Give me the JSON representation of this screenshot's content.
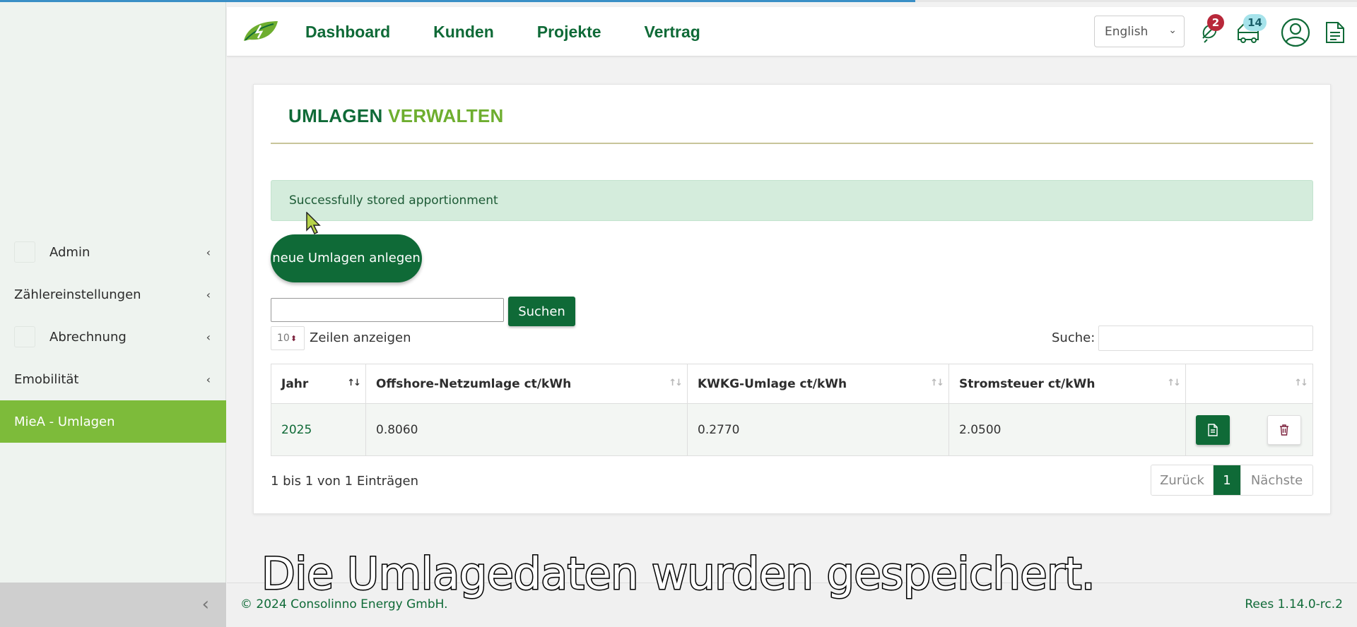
{
  "navigation": {
    "items": [
      "Dashboard",
      "Kunden",
      "Projekte",
      "Vertrag"
    ]
  },
  "header": {
    "language": "English",
    "notifications_count": "2",
    "messages_count": "14"
  },
  "sidebar": {
    "items": [
      {
        "label": "Admin"
      },
      {
        "label": "Zählereinstellungen"
      },
      {
        "label": "Abrechnung"
      },
      {
        "label": "Emobilität"
      },
      {
        "label": "MieA - Umlagen"
      }
    ],
    "active_index": 4
  },
  "page": {
    "title_part1": "UMLAGEN",
    "title_part2": "VERWALTEN",
    "alert": "Successfully stored apportionment",
    "new_button": "neue Umlagen anlegen",
    "search_button": "Suchen",
    "search_value": "",
    "length_value": "10",
    "length_label": "Zeilen anzeigen",
    "filter_label": "Suche:"
  },
  "table": {
    "columns": [
      "Jahr",
      "Offshore-Netzumlage ct/kWh",
      "KWKG-Umlage ct/kWh",
      "Stromsteuer ct/kWh",
      ""
    ],
    "rows": [
      {
        "year": "2025",
        "offshore": "0.8060",
        "kwkg": "0.2770",
        "stromsteuer": "2.0500"
      }
    ],
    "info": "1 bis 1 von 1 Einträgen",
    "pagination": {
      "prev": "Zurück",
      "current": "1",
      "next": "Nächste"
    }
  },
  "caption": "Die Umlagedaten wurden gespeichert.",
  "footer": {
    "copyright": "© 2024 Consolinno Energy GmbH.",
    "version": "Rees 1.14.0-rc.2"
  },
  "colors": {
    "primary": "#0f6a37",
    "accent": "#7dbb3a",
    "alert_bg": "#d4ecdc",
    "badge_red": "#b8283a",
    "badge_cyan": "#a6e3eb"
  }
}
